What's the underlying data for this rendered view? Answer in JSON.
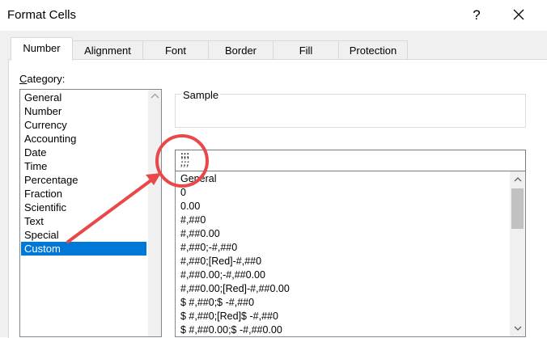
{
  "window": {
    "title": "Format Cells",
    "help_label": "?"
  },
  "tabs": [
    {
      "label": "Number",
      "active": true
    },
    {
      "label": "Alignment",
      "active": false
    },
    {
      "label": "Font",
      "active": false
    },
    {
      "label": "Border",
      "active": false
    },
    {
      "label": "Fill",
      "active": false
    },
    {
      "label": "Protection",
      "active": false
    }
  ],
  "category": {
    "label_accel": "C",
    "label_rest": "ategory:",
    "items": [
      "General",
      "Number",
      "Currency",
      "Accounting",
      "Date",
      "Time",
      "Percentage",
      "Fraction",
      "Scientific",
      "Text",
      "Special",
      "Custom"
    ],
    "selected": "Custom"
  },
  "sample": {
    "label": "Sample"
  },
  "type": {
    "value_line1": ";;;",
    "value_line2": ";;;"
  },
  "formats": [
    "General",
    "0",
    "0.00",
    "#,##0",
    "#,##0.00",
    "#,##0;-#,##0",
    "#,##0;[Red]-#,##0",
    "#,##0.00;-#,##0.00",
    "#,##0.00;[Red]-#,##0.00",
    "$ #,##0;$ -#,##0",
    "$ #,##0;[Red]$ -#,##0",
    "$ #,##0.00;$ -#,##0.00"
  ],
  "colors": {
    "selection": "#0078d7",
    "annotation": "#e8484a"
  },
  "icons": {
    "close": "close-icon",
    "scroll_up": "chevron-up-icon",
    "scroll_down": "chevron-down-icon"
  }
}
